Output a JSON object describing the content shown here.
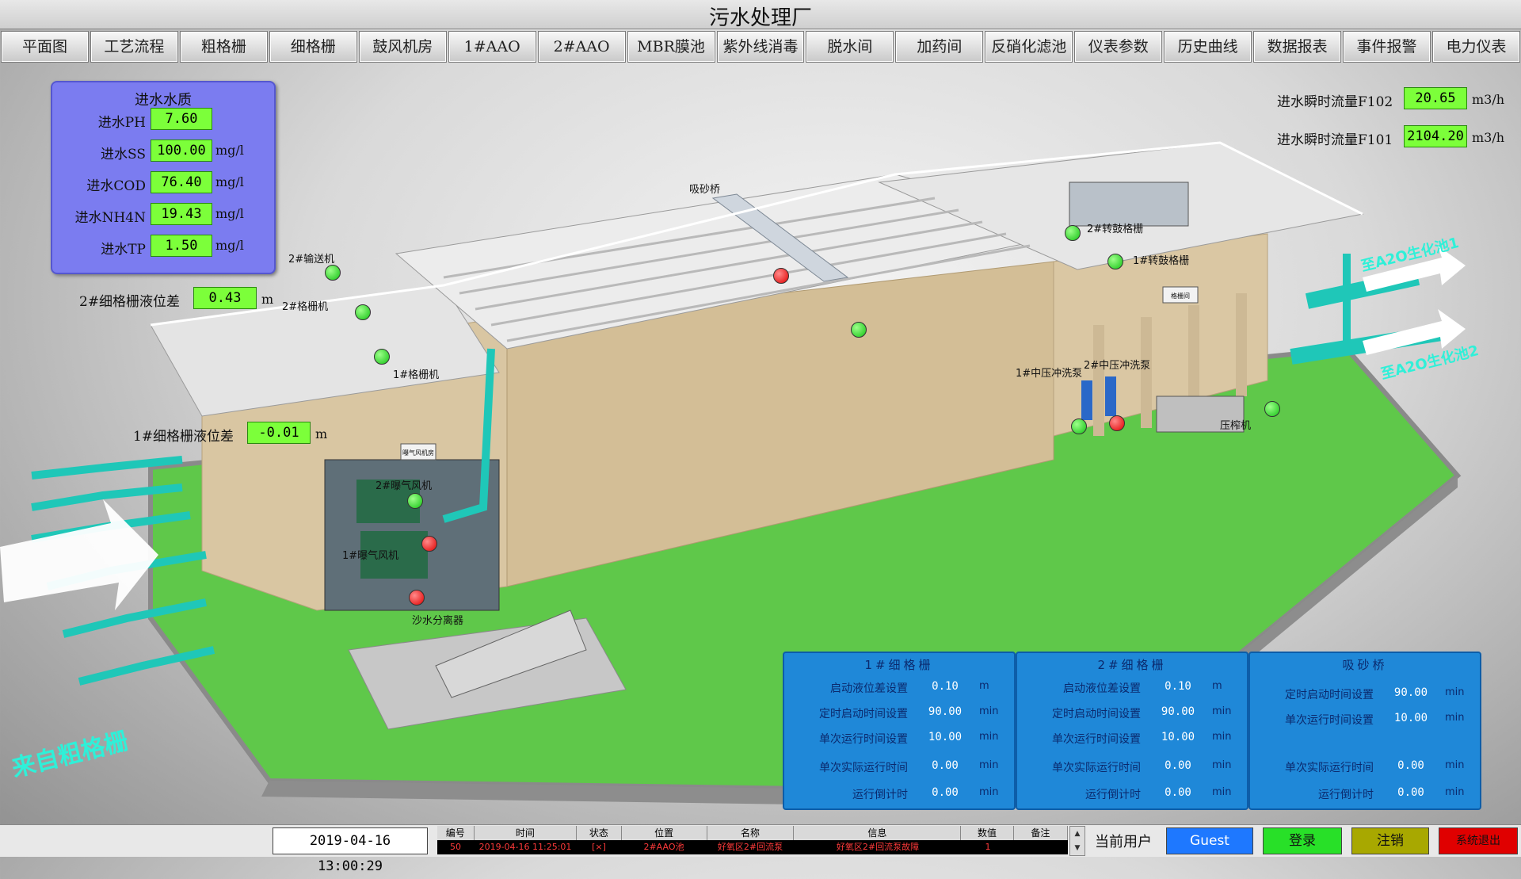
{
  "title": "污水处理厂",
  "nav": [
    "平面图",
    "工艺流程",
    "粗格栅",
    "细格栅",
    "鼓风机房",
    "1#AAO",
    "2#AAO",
    "MBR膜池",
    "紫外线消毒",
    "脱水间",
    "加药间",
    "反硝化滤池",
    "仪表参数",
    "历史曲线",
    "数据报表",
    "事件报警",
    "电力仪表"
  ],
  "inlet_quality": {
    "title": "进水水质",
    "rows": [
      {
        "label": "进水PH",
        "value": "7.60",
        "unit": ""
      },
      {
        "label": "进水SS",
        "value": "100.00",
        "unit": "mg/l"
      },
      {
        "label": "进水COD",
        "value": "76.40",
        "unit": "mg/l"
      },
      {
        "label": "进水NH4N",
        "value": "19.43",
        "unit": "mg/l"
      },
      {
        "label": "进水TP",
        "value": "1.50",
        "unit": "mg/l"
      }
    ]
  },
  "level_diff_2": {
    "label": "2#细格栅液位差",
    "value": "0.43",
    "unit": "m"
  },
  "level_diff_1": {
    "label": "1#细格栅液位差",
    "value": "-0.01",
    "unit": "m"
  },
  "flow_f102": {
    "label": "进水瞬时流量F102",
    "value": "20.65",
    "unit": "m3/h"
  },
  "flow_f101": {
    "label": "进水瞬时流量F101",
    "value": "2104.20",
    "unit": "m3/h"
  },
  "equipment": {
    "conveyor2": "2#输送机",
    "grille2": "2#格栅机",
    "grille1": "1#格栅机",
    "sand_bridge": "吸砂桥",
    "drum2": "2#转鼓格栅",
    "drum1": "1#转鼓格栅",
    "pump1": "1#中压冲洗泵",
    "pump2": "2#中压冲洗泵",
    "compactor": "压榨机",
    "blower2": "2#曝气风机",
    "blower1": "1#曝气风机",
    "separator": "沙水分离器",
    "house_sign": "曝气风机房",
    "grille_sign": "格栅间"
  },
  "arrows": {
    "to_a2o_1": "至A2O生化池1",
    "to_a2o_2": "至A2O生化池2",
    "from_coarse": "来自粗格栅"
  },
  "panel_fine1": {
    "title": "1#细格栅",
    "rows": [
      {
        "label": "启动液位差设置",
        "value": "0.10",
        "unit": "m"
      },
      {
        "label": "定时启动时间设置",
        "value": "90.00",
        "unit": "min"
      },
      {
        "label": "单次运行时间设置",
        "value": "10.00",
        "unit": "min"
      },
      {
        "label": "单次实际运行时间",
        "value": "0.00",
        "unit": "min"
      },
      {
        "label": "运行倒计时",
        "value": "0.00",
        "unit": "min"
      }
    ]
  },
  "panel_fine2": {
    "title": "2#细格栅",
    "rows": [
      {
        "label": "启动液位差设置",
        "value": "0.10",
        "unit": "m"
      },
      {
        "label": "定时启动时间设置",
        "value": "90.00",
        "unit": "min"
      },
      {
        "label": "单次运行时间设置",
        "value": "10.00",
        "unit": "min"
      },
      {
        "label": "单次实际运行时间",
        "value": "0.00",
        "unit": "min"
      },
      {
        "label": "运行倒计时",
        "value": "0.00",
        "unit": "min"
      }
    ]
  },
  "panel_sand": {
    "title": "吸砂桥",
    "rows": [
      {
        "label": "定时启动时间设置",
        "value": "90.00",
        "unit": "min"
      },
      {
        "label": "单次运行时间设置",
        "value": "10.00",
        "unit": "min"
      },
      {
        "label": "单次实际运行时间",
        "value": "0.00",
        "unit": "min"
      },
      {
        "label": "运行倒计时",
        "value": "0.00",
        "unit": "min"
      }
    ]
  },
  "datetime": "2019-04-16 13:00:29",
  "events": {
    "headers": [
      "编号",
      "时间",
      "状态",
      "位置",
      "名称",
      "信息",
      "数值",
      "备注"
    ],
    "row": [
      "50",
      "2019-04-16 11:25:01",
      "[×]",
      "2#AAO池",
      "好氧区2#回流泵",
      "好氧区2#回流泵故障",
      "1",
      ""
    ]
  },
  "user": {
    "label": "当前用户",
    "name": "Guest",
    "login": "登录",
    "logout": "注销",
    "exit": "系统退出"
  },
  "colors": {
    "value_bg": "#7cff3a",
    "panel_blue": "#1f88d8",
    "quality_panel": "#7b7cf0",
    "pipe": "#1fc7b8",
    "grass": "#5fc84a"
  }
}
